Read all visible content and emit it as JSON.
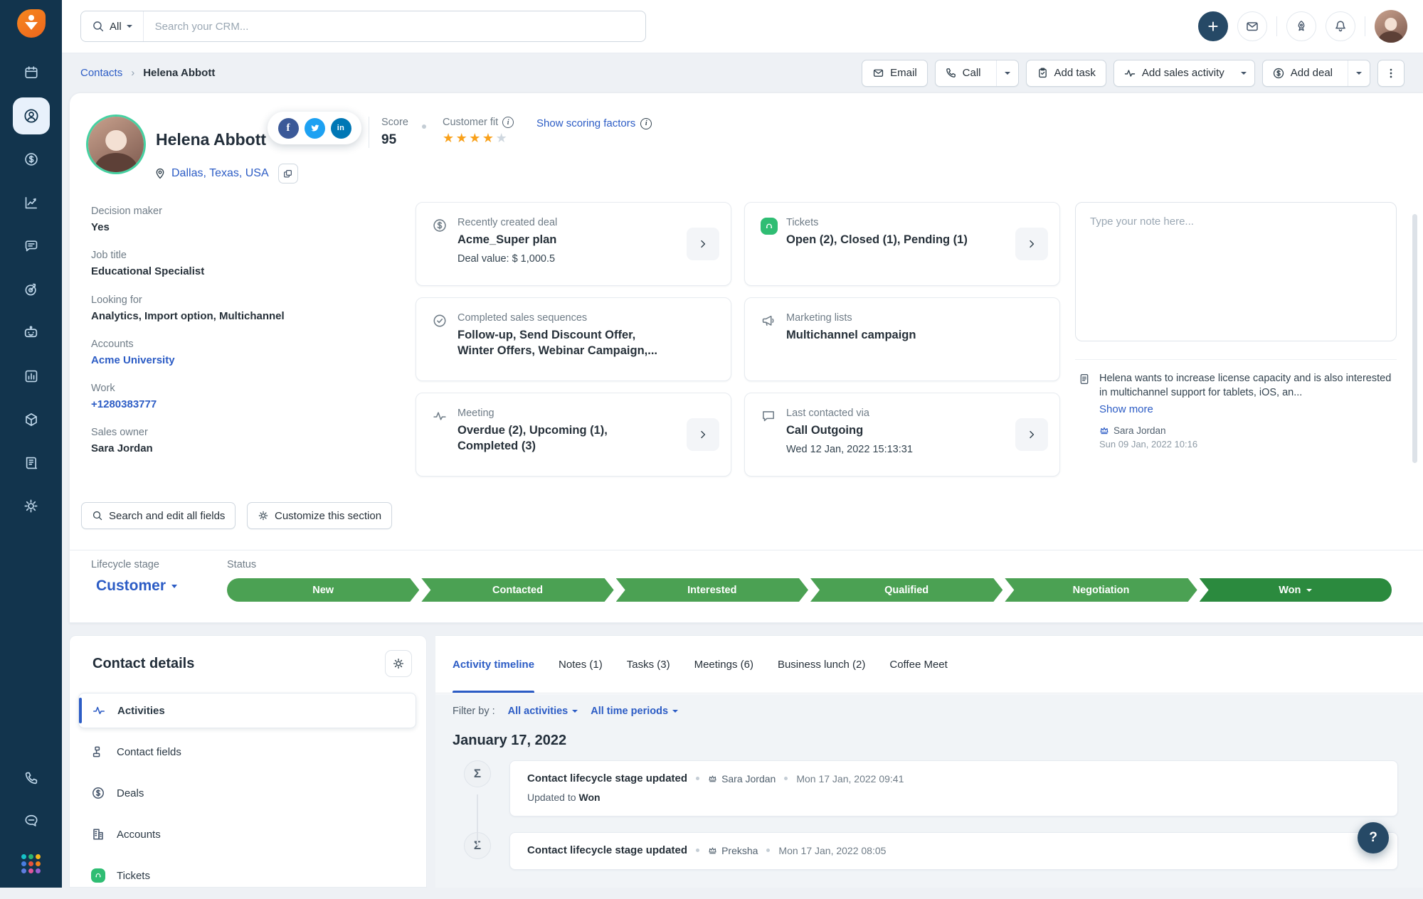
{
  "topbar": {
    "scope": "All",
    "search_placeholder": "Search your CRM..."
  },
  "breadcrumb": {
    "parent": "Contacts",
    "current": "Helena Abbott"
  },
  "actions": {
    "email": "Email",
    "call": "Call",
    "add_task": "Add task",
    "add_sales_activity": "Add sales activity",
    "add_deal": "Add deal"
  },
  "contact": {
    "name": "Helena Abbott",
    "location": "Dallas, Texas, USA",
    "score_label": "Score",
    "score": "95",
    "customer_fit_label": "Customer fit",
    "stars_filled": 4,
    "stars_total": 5,
    "scoring_link": "Show scoring factors",
    "social": [
      "facebook",
      "twitter",
      "linkedin"
    ]
  },
  "fields": [
    {
      "label": "Decision maker",
      "value": "Yes"
    },
    {
      "label": "Job title",
      "value": "Educational Specialist"
    },
    {
      "label": "Looking for",
      "value": "Analytics, Import option, Multichannel"
    },
    {
      "label": "Accounts",
      "value": "Acme University"
    },
    {
      "label": "Work",
      "value": "+1280383777"
    },
    {
      "label": "Sales owner",
      "value": "Sara Jordan"
    }
  ],
  "cards": [
    {
      "label": "Recently created deal",
      "title": "Acme_Super plan",
      "sub": "Deal value: $ 1,000.5",
      "icon": "deal-dollar-icon"
    },
    {
      "label": "Tickets",
      "title": "Open (2), Closed (1), Pending (1)",
      "icon": "freshdesk-ticket-icon"
    },
    {
      "label": "Completed sales sequences",
      "title": "Follow-up, Send Discount Offer, Winter Offers, Webinar Campaign,...",
      "icon": "sequence-check-icon"
    },
    {
      "label": "Marketing lists",
      "title": "Multichannel campaign",
      "icon": "megaphone-icon"
    },
    {
      "label": "Meeting",
      "title": "Overdue (2), Upcoming (1), Completed (3)",
      "icon": "activity-pulse-icon"
    },
    {
      "label": "Last contacted via",
      "title": "Call Outgoing",
      "sub": "Wed 12 Jan, 2022 15:13:31",
      "icon": "chat-bubble-icon"
    }
  ],
  "notes": {
    "placeholder": "Type your note here...",
    "note": {
      "text": "Helena wants to increase license capacity and is also interested in multichannel support for tablets, iOS, an...",
      "show_more": "Show more",
      "author": "Sara Jordan",
      "date": "Sun 09 Jan, 2022 10:16"
    }
  },
  "section_actions": {
    "search_edit": "Search and edit all fields",
    "customize": "Customize this section"
  },
  "lifecycle": {
    "label": "Lifecycle stage",
    "value": "Customer",
    "status_label": "Status",
    "stages": [
      "New",
      "Contacted",
      "Interested",
      "Qualified",
      "Negotiation",
      "Won"
    ],
    "stage_color": "#4ba153",
    "won_color": "#2b8a3e"
  },
  "details_panel": {
    "title": "Contact details",
    "items": [
      {
        "label": "Activities",
        "active": true
      },
      {
        "label": "Contact fields",
        "active": false
      },
      {
        "label": "Deals",
        "active": false
      },
      {
        "label": "Accounts",
        "active": false
      },
      {
        "label": "Tickets",
        "active": false
      }
    ]
  },
  "timeline_tabs": [
    "Activity timeline",
    "Notes (1)",
    "Tasks (3)",
    "Meetings (6)",
    "Business lunch (2)",
    "Coffee Meet"
  ],
  "filter": {
    "label": "Filter by :",
    "activities": "All activities",
    "periods": "All time periods"
  },
  "date_header": "January 17, 2022",
  "timeline": [
    {
      "title": "Contact lifecycle stage updated",
      "author": "Sara Jordan",
      "time": "Mon 17 Jan, 2022 09:41",
      "body_prefix": "Updated to",
      "body_value": "Won"
    },
    {
      "title": "Contact lifecycle stage updated",
      "author": "Preksha",
      "time": "Mon 17 Jan, 2022 08:05"
    }
  ],
  "help_label": "?",
  "sidebar_icons": [
    "calendar",
    "contacts",
    "deals",
    "analytics",
    "conversations",
    "goals",
    "bot",
    "reports",
    "products",
    "documents",
    "settings",
    "phone",
    "chat",
    "apps-switcher"
  ],
  "colors": {
    "accent_blue": "#2c5cc5",
    "sidebar_navy": "#12344d",
    "star_orange": "#f9a11b",
    "freshworks_orange": "#f6871f",
    "tickets_green": "#2fbd73"
  }
}
